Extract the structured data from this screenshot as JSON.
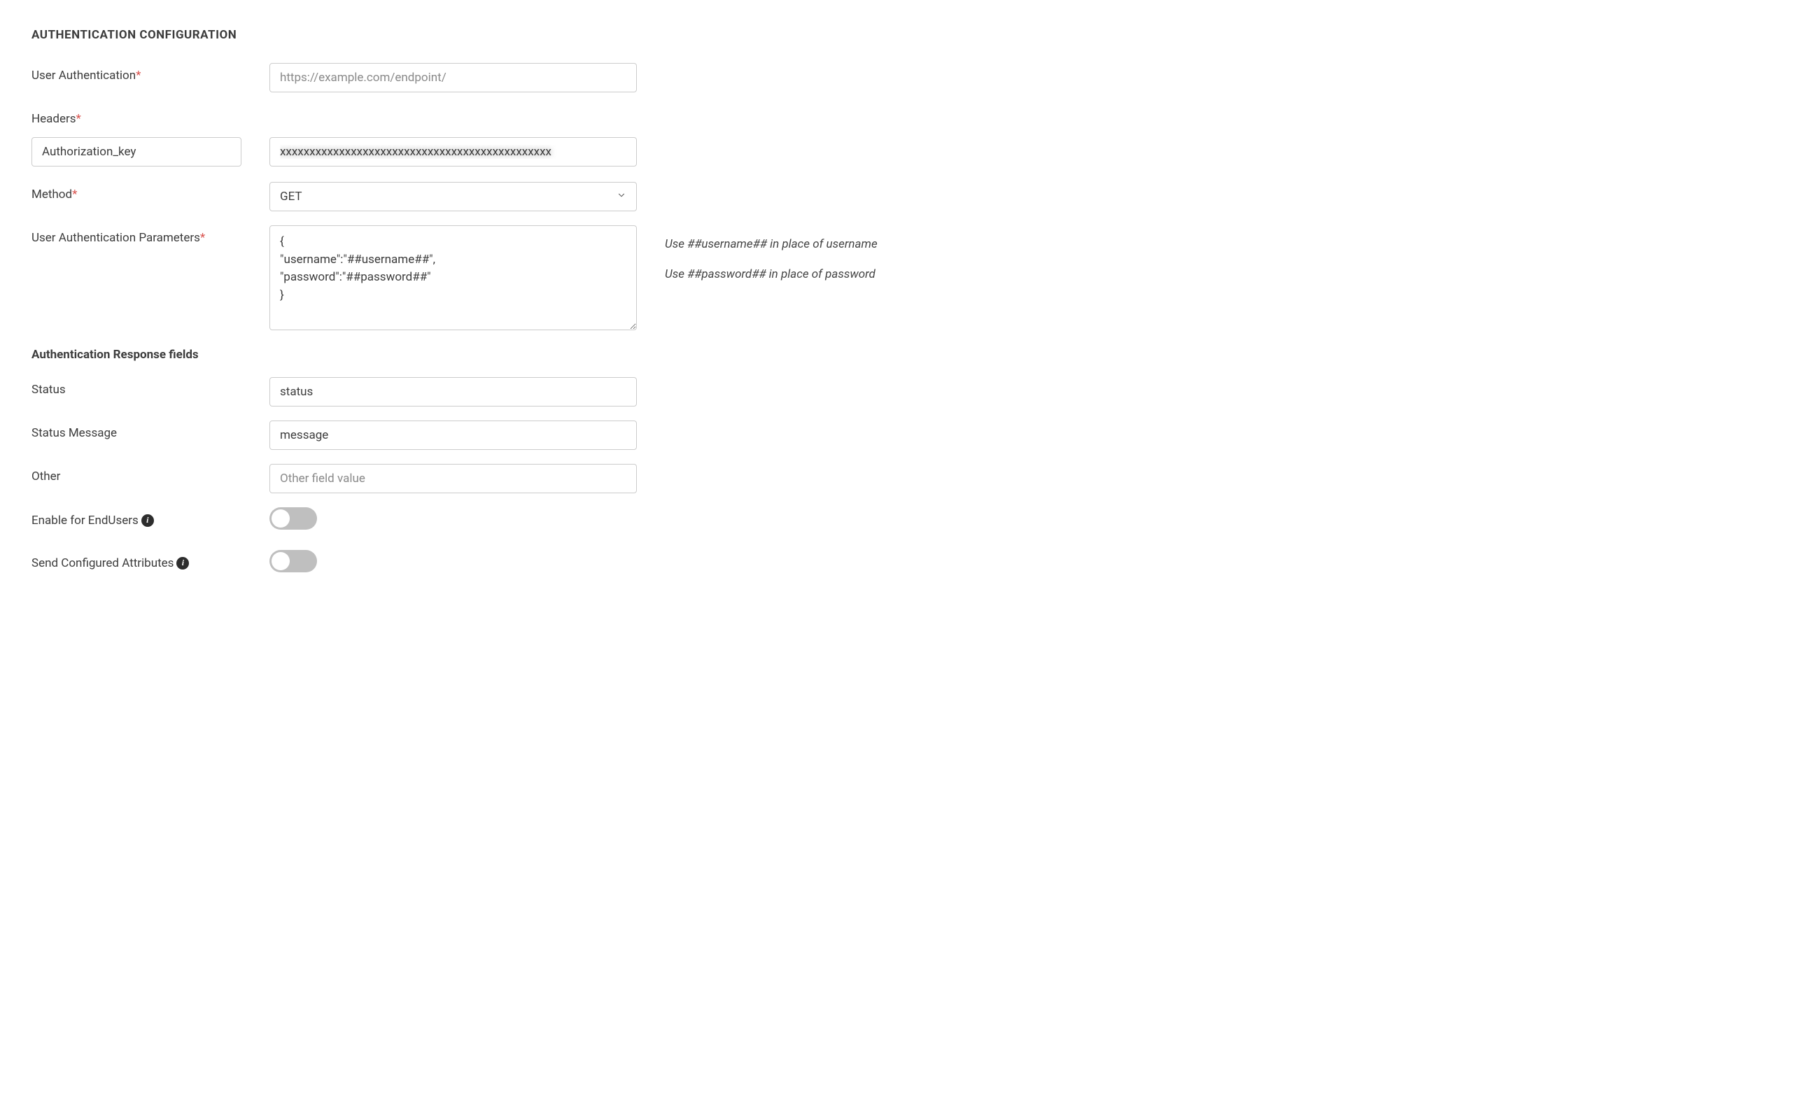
{
  "section_title": "AUTHENTICATION CONFIGURATION",
  "labels": {
    "user_auth": "User Authentication",
    "headers": "Headers",
    "method": "Method",
    "user_auth_params": "User Authentication Parameters",
    "status": "Status",
    "status_message": "Status Message",
    "other": "Other",
    "enable_endusers": "Enable for EndUsers",
    "send_configured_attrs": "Send Configured Attributes"
  },
  "subsection_title": "Authentication Response fields",
  "fields": {
    "user_auth_placeholder": "https://example.com/endpoint/",
    "header_key_value": "Authorization_key",
    "header_value_obscured": "xxxxxxxxxxxxxxxxxxxxxxxxxxxxxxxxxxxxxxxxxxxxxx",
    "method_selected": "GET",
    "user_auth_params_value": "{\n\"username\":\"##username##\",\n\"password\":\"##password##\"\n}",
    "status_value": "status",
    "status_message_value": "message",
    "other_placeholder": "Other field value"
  },
  "hints": {
    "username_hint": "Use ##username## in place of username",
    "password_hint": "Use ##password## in place of password"
  },
  "toggles": {
    "enable_endusers": false,
    "send_configured_attrs": false
  },
  "colors": {
    "required": "#d9534f",
    "border": "#cccccc",
    "toggle_off": "#bfbfbf"
  }
}
